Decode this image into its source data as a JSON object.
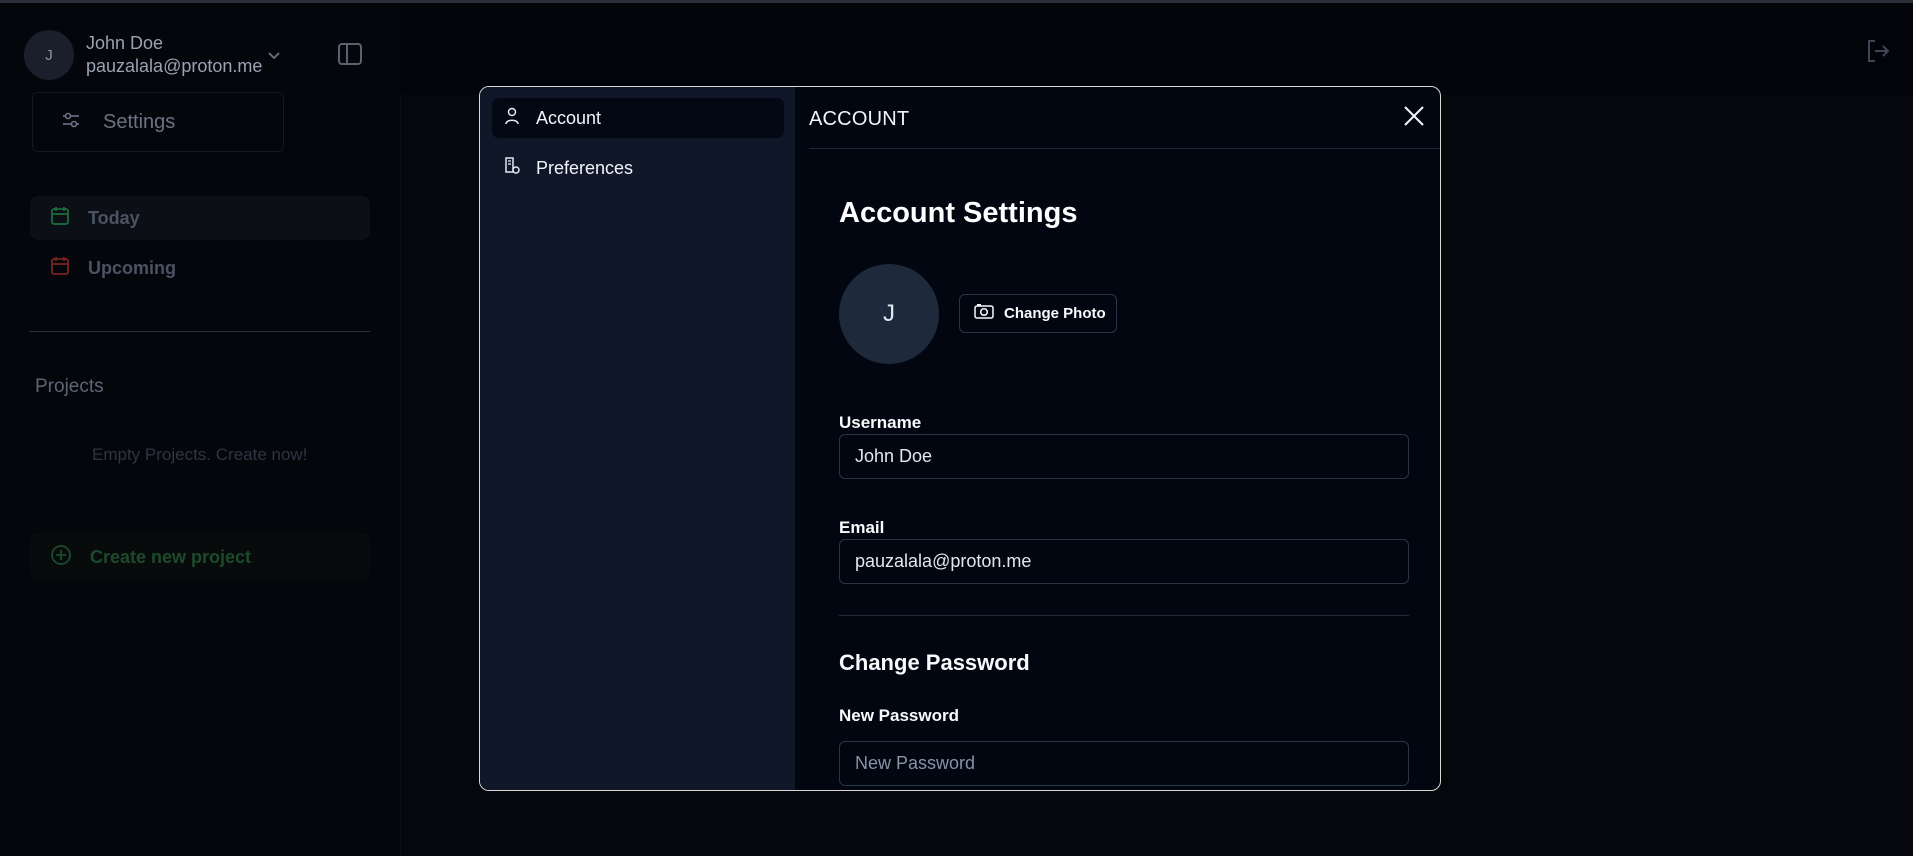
{
  "user": {
    "avatar_initial": "J",
    "name": "John Doe",
    "email": "pauzalala@proton.me"
  },
  "sidebar": {
    "settings_label": "Settings",
    "nav": [
      {
        "label": "Today",
        "icon": "calendar-check-icon",
        "color": "#22c55e"
      },
      {
        "label": "Upcoming",
        "icon": "calendar-icon",
        "color": "#ef4444"
      }
    ],
    "projects_title": "Projects",
    "empty_projects": "Empty Projects. Create now!",
    "create_project": "Create new project"
  },
  "modal": {
    "nav": [
      {
        "label": "Account",
        "icon": "user-icon",
        "active": true
      },
      {
        "label": "Preferences",
        "icon": "preferences-icon",
        "active": false
      }
    ],
    "heading": "ACCOUNT",
    "title": "Account Settings",
    "avatar_initial": "J",
    "change_photo": "Change Photo",
    "username_label": "Username",
    "username_value": "John Doe",
    "email_label": "Email",
    "email_value": "pauzalala@proton.me",
    "password_section": "Change Password",
    "new_password_label": "New Password",
    "new_password_placeholder": "New Password"
  },
  "colors": {
    "modal_bg": "#020611",
    "modal_nav_bg": "#0f1729",
    "modal_border": "#d8d8d2",
    "today_green": "#22c55e",
    "upcoming_red": "#ef4444"
  }
}
